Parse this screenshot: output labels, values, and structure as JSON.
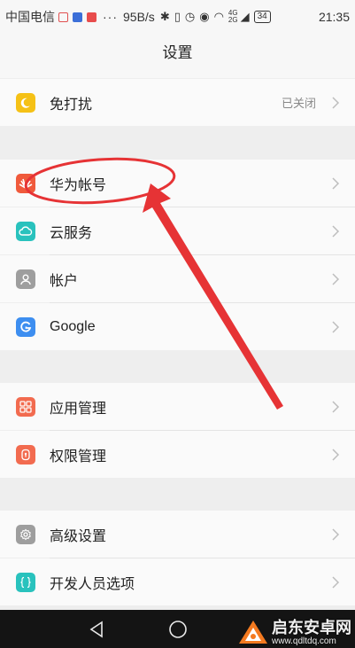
{
  "status_bar": {
    "carrier": "中国电信",
    "dots": "···",
    "speed": "95B/s",
    "network": "4G",
    "network_sub": "2G",
    "battery": "34",
    "time": "21:35"
  },
  "header": {
    "title": "设置"
  },
  "groups": [
    {
      "items": [
        {
          "label": "免打扰",
          "value": "已关闭",
          "icon": "moon-icon",
          "color": "#f5c116"
        }
      ]
    },
    {
      "items": [
        {
          "label": "华为帐号",
          "icon": "huawei-icon",
          "color": "#f05a3c"
        },
        {
          "label": "云服务",
          "icon": "cloud-icon",
          "color": "#29c2bd"
        },
        {
          "label": "帐户",
          "icon": "user-icon",
          "color": "#9e9e9e"
        },
        {
          "label": "Google",
          "icon": "google-icon",
          "color": "#3d8ef0"
        }
      ]
    },
    {
      "items": [
        {
          "label": "应用管理",
          "icon": "apps-icon",
          "color": "#f26b4f"
        },
        {
          "label": "权限管理",
          "icon": "shield-icon",
          "color": "#f26b4f"
        }
      ]
    },
    {
      "items": [
        {
          "label": "高级设置",
          "icon": "gear-icon",
          "color": "#9e9e9e"
        },
        {
          "label": "开发人员选项",
          "icon": "braces-icon",
          "color": "#29c2bd"
        }
      ]
    }
  ],
  "watermark": {
    "name": "启东安卓网",
    "url": "www.qdltdq.com"
  },
  "annotation_color": "#e63335"
}
